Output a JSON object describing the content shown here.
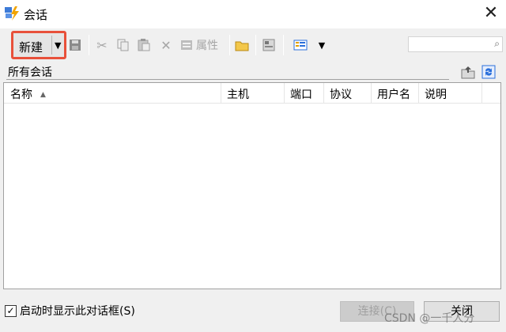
{
  "window": {
    "title": "会话"
  },
  "toolbar": {
    "new_label": "新建",
    "properties_label": "属性",
    "search_placeholder": ""
  },
  "path": {
    "label": "所有会话"
  },
  "table": {
    "columns": [
      "名称",
      "主机",
      "端口",
      "协议",
      "用户名",
      "说明"
    ],
    "rows": []
  },
  "footer": {
    "checkbox_label": "启动时显示此对话框(S)",
    "checkbox_checked": true,
    "connect_label": "连接(C)",
    "close_label": "关闭"
  },
  "watermark": "CSDN @一千人分",
  "colors": {
    "highlight": "#e8503a",
    "accent_blue": "#2a6fdb"
  }
}
